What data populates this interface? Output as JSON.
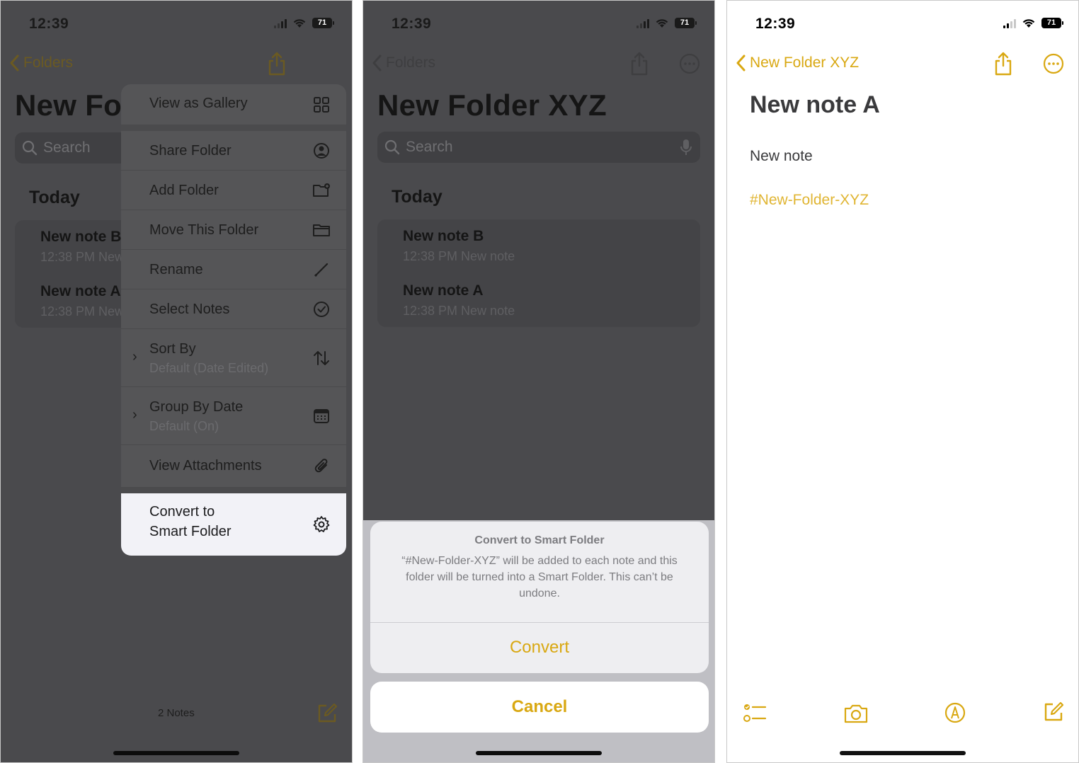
{
  "colors": {
    "accent": "#d9a812",
    "dim_overlay": "#4a4a4d",
    "menu_bg": "#555557",
    "highlight": "#f2f2f7"
  },
  "panel1": {
    "status": {
      "time": "12:39",
      "battery": "71"
    },
    "nav": {
      "back_label": "Folders"
    },
    "folder_title": "New Fo",
    "search_placeholder": "Search",
    "section": "Today",
    "notes": [
      {
        "title": "New note B",
        "meta": "12:38 PM  New note"
      },
      {
        "title": "New note A",
        "meta": "12:38 PM  New note"
      }
    ],
    "menu": {
      "view_gallery": "View as Gallery",
      "share_folder": "Share Folder",
      "add_folder": "Add Folder",
      "move_folder": "Move This Folder",
      "rename": "Rename",
      "select_notes": "Select Notes",
      "sort_by": "Sort By",
      "sort_by_value": "Default (Date Edited)",
      "group_by": "Group By Date",
      "group_by_value": "Default (On)",
      "view_attachments": "View Attachments",
      "convert_line1": "Convert to",
      "convert_line2": "Smart Folder"
    },
    "footer_count": "2 Notes"
  },
  "panel2": {
    "status": {
      "time": "12:39",
      "battery": "71"
    },
    "nav": {
      "back_label": "Folders"
    },
    "folder_title": "New Folder XYZ",
    "search_placeholder": "Search",
    "section": "Today",
    "notes": [
      {
        "title": "New note B",
        "meta": "12:38 PM  New note"
      },
      {
        "title": "New note A",
        "meta": "12:38 PM  New note"
      }
    ],
    "alert": {
      "title": "Convert to Smart Folder",
      "message": "“#New-Folder-XYZ” will be added to each note and this folder will be turned into a Smart Folder. This can’t be undone.",
      "convert": "Convert",
      "cancel": "Cancel"
    }
  },
  "panel3": {
    "status": {
      "time": "12:39",
      "battery": "71"
    },
    "nav": {
      "back_label": "New Folder XYZ"
    },
    "note_title": "New note A",
    "note_body": "New note",
    "tag": "#New-Folder-XYZ"
  },
  "icons": [
    "chevron-left-icon",
    "share-icon",
    "more-icon",
    "search-icon",
    "mic-icon",
    "grid-icon",
    "person-circle-icon",
    "folder-plus-icon",
    "folder-icon",
    "pencil-icon",
    "checkmark-circle-icon",
    "sort-arrows-icon",
    "calendar-icon",
    "paperclip-icon",
    "gear-icon",
    "compose-icon",
    "checklist-icon",
    "camera-icon",
    "markup-icon",
    "wifi-icon",
    "signal-icon",
    "battery-icon"
  ]
}
